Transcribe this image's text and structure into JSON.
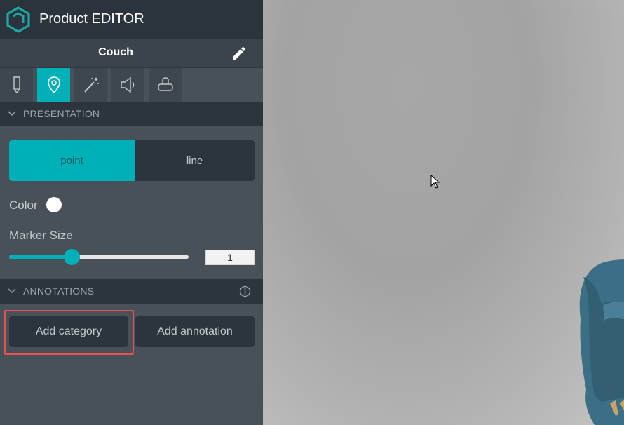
{
  "app": {
    "title": "Product EDITOR"
  },
  "product": {
    "name": "Couch"
  },
  "tabs": [
    {
      "icon": "pencil-icon"
    },
    {
      "icon": "location-pin-icon",
      "active": true
    },
    {
      "icon": "magic-wand-icon"
    },
    {
      "icon": "speaker-icon"
    },
    {
      "icon": "vr-headset-icon"
    }
  ],
  "presentation": {
    "header": "PRESENTATION",
    "options": {
      "point": "point",
      "line": "line"
    },
    "selected": "point",
    "color_label": "Color",
    "color_value": "#ffffff",
    "marker_size_label": "Marker Size",
    "marker_size_value": "1",
    "marker_slider_fraction": 0.35
  },
  "annotations": {
    "header": "ANNOTATIONS",
    "add_category_label": "Add category",
    "add_annotation_label": "Add annotation"
  },
  "colors": {
    "accent": "#00b0b9",
    "sidebar_bg": "#485158",
    "header_bg": "#2b333d",
    "highlight": "#e8524f"
  }
}
